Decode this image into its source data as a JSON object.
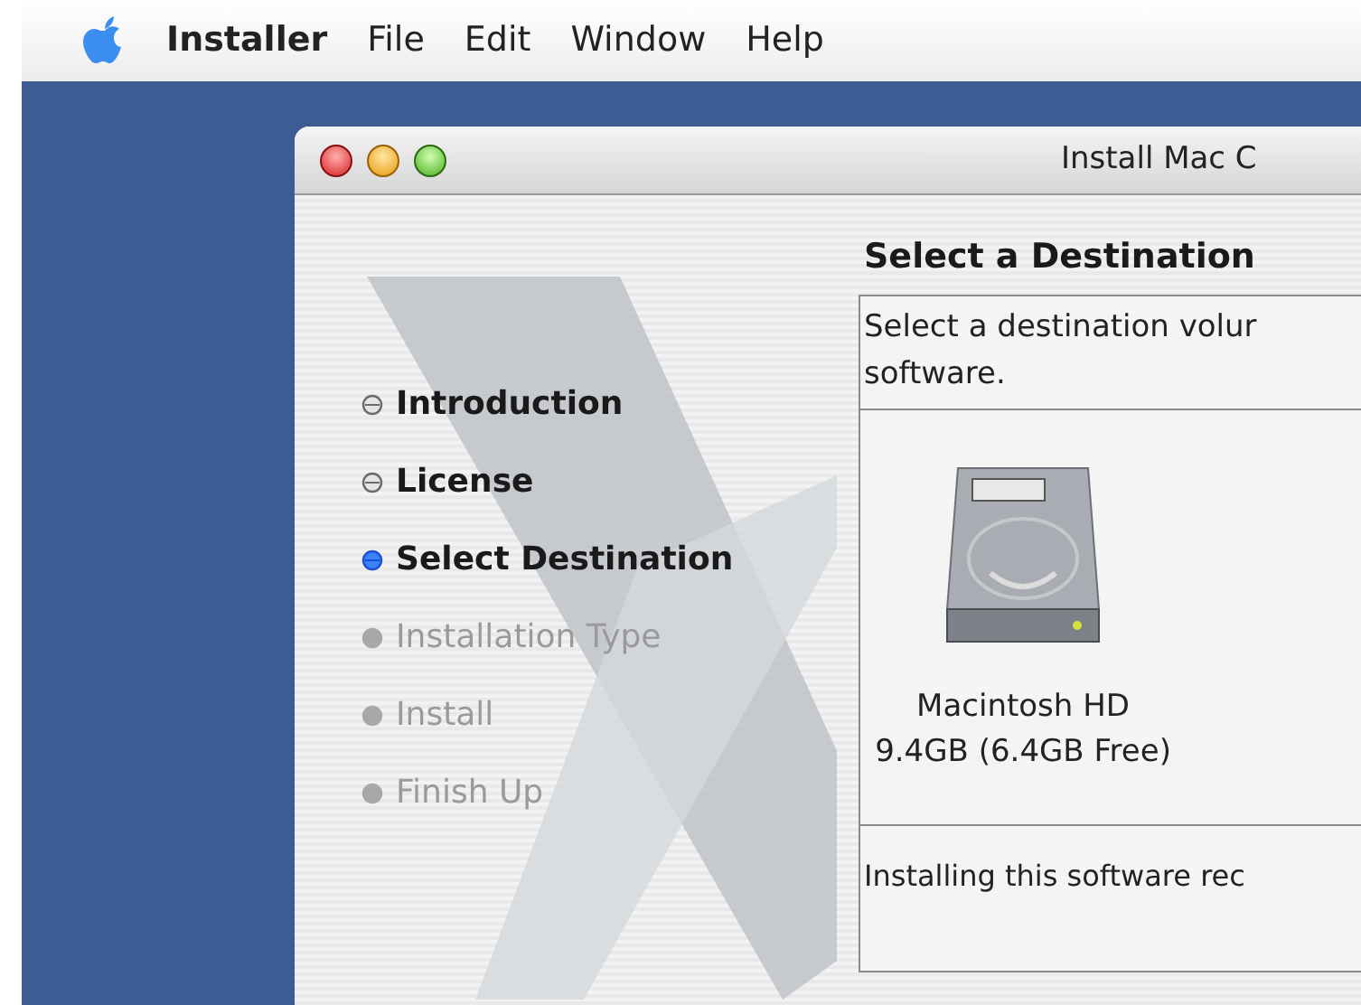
{
  "menu_bar": {
    "items": [
      {
        "label": "Installer",
        "kind": "app"
      },
      {
        "label": "File",
        "kind": "menu"
      },
      {
        "label": "Edit",
        "kind": "menu"
      },
      {
        "label": "Window",
        "kind": "menu"
      },
      {
        "label": "Help",
        "kind": "menu"
      }
    ]
  },
  "window": {
    "title": "Install Mac C"
  },
  "steps": [
    {
      "label": "Introduction",
      "completed": true,
      "selected": false
    },
    {
      "label": "License",
      "completed": true,
      "selected": false
    },
    {
      "label": "Select Destination",
      "completed": false,
      "selected": true
    },
    {
      "label": "Installation Type",
      "completed": false,
      "selected": false
    },
    {
      "label": "Install",
      "completed": false,
      "selected": false
    },
    {
      "label": "Finish Up",
      "completed": false,
      "selected": false
    }
  ],
  "panel": {
    "heading": "Select a Destination",
    "instructions": [
      "Select a destination volur",
      "software."
    ],
    "volumes": [
      {
        "name": "Macintosh HD",
        "size": "9.4GB (6.4GB Free)"
      }
    ],
    "footer": "Installing this software rec"
  }
}
